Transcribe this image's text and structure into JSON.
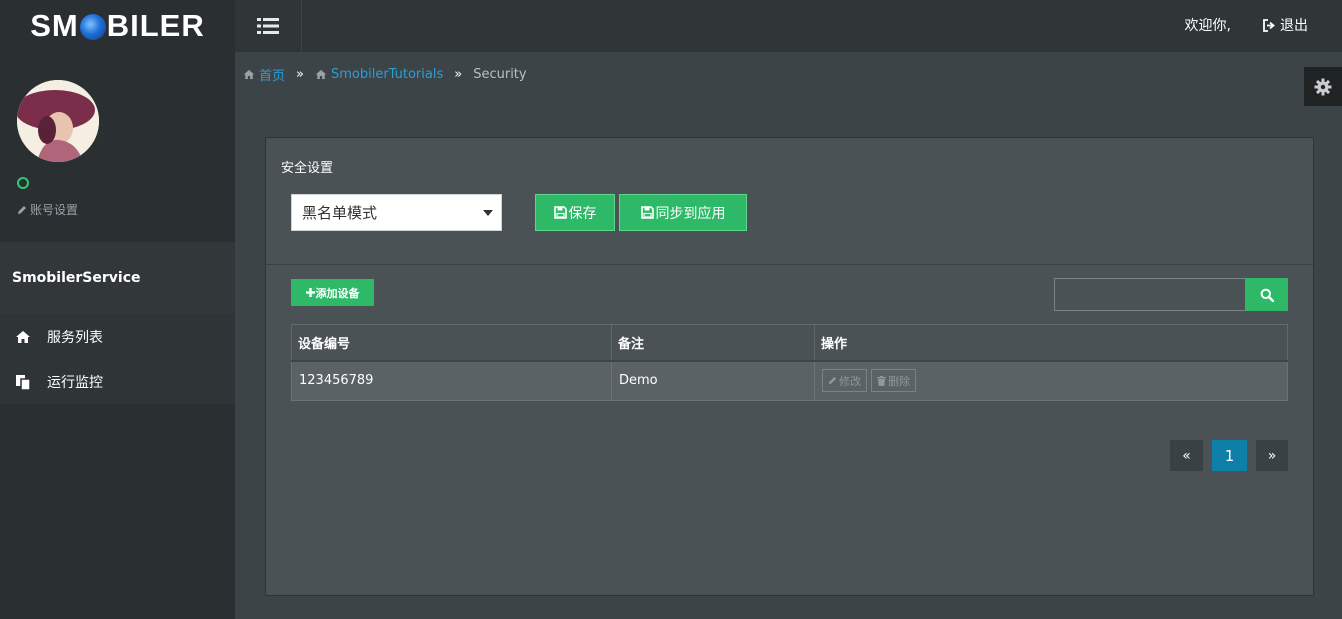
{
  "brand": {
    "name_left": "SM",
    "name_right": "BILER"
  },
  "header": {
    "welcome": "欢迎你,",
    "logout_label": "退出"
  },
  "sidebar": {
    "account_settings": "账号设置",
    "service_name": "SmobilerService",
    "items": [
      {
        "label": "服务列表",
        "icon": "home-icon"
      },
      {
        "label": "运行监控",
        "icon": "copy-icon"
      }
    ]
  },
  "breadcrumb": {
    "home": "首页",
    "project": "SmobilerTutorials",
    "current": "Security",
    "separator": "»"
  },
  "panel": {
    "title": "安全设置",
    "mode_select": {
      "selected": "黑名单模式"
    },
    "save_label": "保存",
    "sync_label": "同步到应用",
    "add_device_label": "添加设备",
    "search": {
      "value": "",
      "placeholder": ""
    }
  },
  "table": {
    "headers": [
      "设备编号",
      "备注",
      "操作"
    ],
    "rows": [
      {
        "device_id": "123456789",
        "note": "Demo",
        "edit_label": "修改",
        "delete_label": "删除"
      }
    ]
  },
  "pagination": {
    "prev": "«",
    "current": "1",
    "next": "»"
  },
  "colors": {
    "accent_green": "#2db968",
    "link_blue": "#2a9fd6",
    "page_active": "#0e7fa6"
  }
}
